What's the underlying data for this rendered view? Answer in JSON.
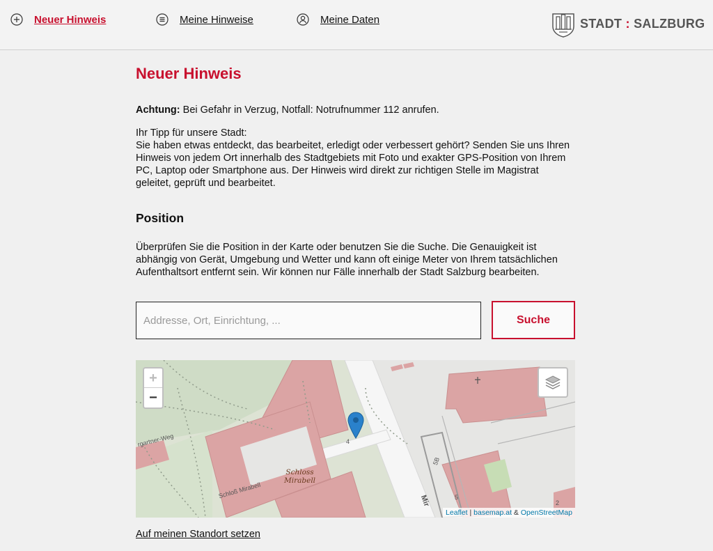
{
  "nav": {
    "items": [
      {
        "label": "Neuer Hinweis",
        "icon": "plus-circle-icon",
        "active": true
      },
      {
        "label": "Meine Hinweise",
        "icon": "list-circle-icon",
        "active": false
      },
      {
        "label": "Meine Daten",
        "icon": "user-circle-icon",
        "active": false
      }
    ]
  },
  "logo": {
    "part1": "STADT",
    "sep": ":",
    "part2": "SALZBURG"
  },
  "page": {
    "title": "Neuer Hinweis",
    "warning_bold": "Achtung:",
    "warning_text": " Bei Gefahr in Verzug, Notfall: Notrufnummer 112 anrufen.",
    "intro_line1": "Ihr Tipp für unsere Stadt:",
    "intro_line2": "Sie haben etwas entdeckt, das bearbeitet, erledigt oder verbessert gehört? Senden Sie uns Ihren Hinweis von jedem Ort innerhalb des Stadtgebiets mit Foto und exakter GPS-Position von Ihrem PC, Laptop oder Smartphone aus. Der Hinweis wird direkt zur richtigen Stelle im Magistrat geleitet, geprüft und bearbeitet.",
    "position_heading": "Position",
    "position_text": "Überprüfen Sie die Position in der Karte oder benutzen Sie die Suche. Die Genauigkeit ist abhängig von Gerät, Umgebung und Wetter und kann oft einige Meter von Ihrem tatsächlichen Aufenthaltsort entfernt sein. Wir können nur Fälle innerhalb der Stadt Salzburg bearbeiten."
  },
  "search": {
    "placeholder": "Addresse, Ort, Einrichtung, ...",
    "value": "",
    "button_label": "Suche"
  },
  "map": {
    "zoom_in": "+",
    "zoom_out": "−",
    "place_label_1": "Schloss",
    "place_label_2": "Mirabell",
    "street_1": "rgartner-Weg",
    "street_2": "Schloß Mirabell",
    "street_3": "Mir",
    "house_4": "4",
    "house_5b": "5B",
    "house_5": "5",
    "house_2": "2",
    "attribution": {
      "leaflet": "Leaflet",
      "sep1": " | ",
      "basemap": "basemap.at",
      "amp": " & ",
      "osm": "OpenStreetMap"
    },
    "colors": {
      "building": "#dba4a4",
      "park": "#cfdcc6",
      "road": "#f6f6f6",
      "marker": "#2a81cb"
    }
  },
  "locate_link": "Auf meinen Standort setzen",
  "accent_color": "#c8102e"
}
